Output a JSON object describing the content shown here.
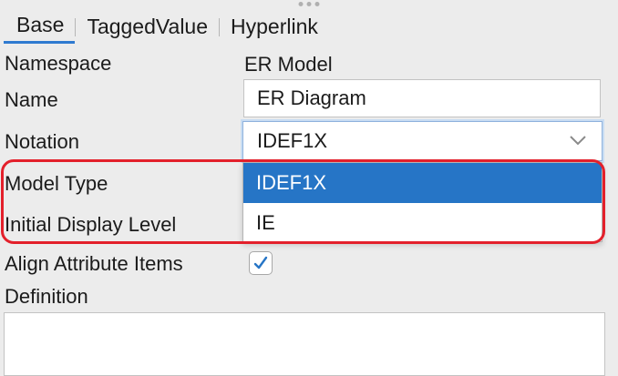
{
  "tabs": [
    {
      "label": "Base",
      "active": true
    },
    {
      "label": "TaggedValue",
      "active": false
    },
    {
      "label": "Hyperlink",
      "active": false
    }
  ],
  "fields": {
    "namespace": {
      "label": "Namespace",
      "value": "ER Model"
    },
    "name": {
      "label": "Name",
      "value": "ER Diagram"
    },
    "notation": {
      "label": "Notation",
      "value": "IDEF1X"
    },
    "model_type": {
      "label": "Model Type"
    },
    "initial_display_level": {
      "label": "Initial Display Level"
    },
    "align_attribute_items": {
      "label": "Align Attribute Items",
      "checked": true
    },
    "definition": {
      "label": "Definition",
      "value": ""
    }
  },
  "notation_dropdown": {
    "options": [
      "IDEF1X",
      "IE"
    ],
    "selected": "IDEF1X"
  },
  "colors": {
    "accent": "#2675c6",
    "highlight": "#e3202b",
    "background": "#ececec"
  },
  "icons": {
    "grip": "ellipsis-grip-icon",
    "chevron": "chevron-down-icon",
    "check": "checkmark-icon"
  }
}
